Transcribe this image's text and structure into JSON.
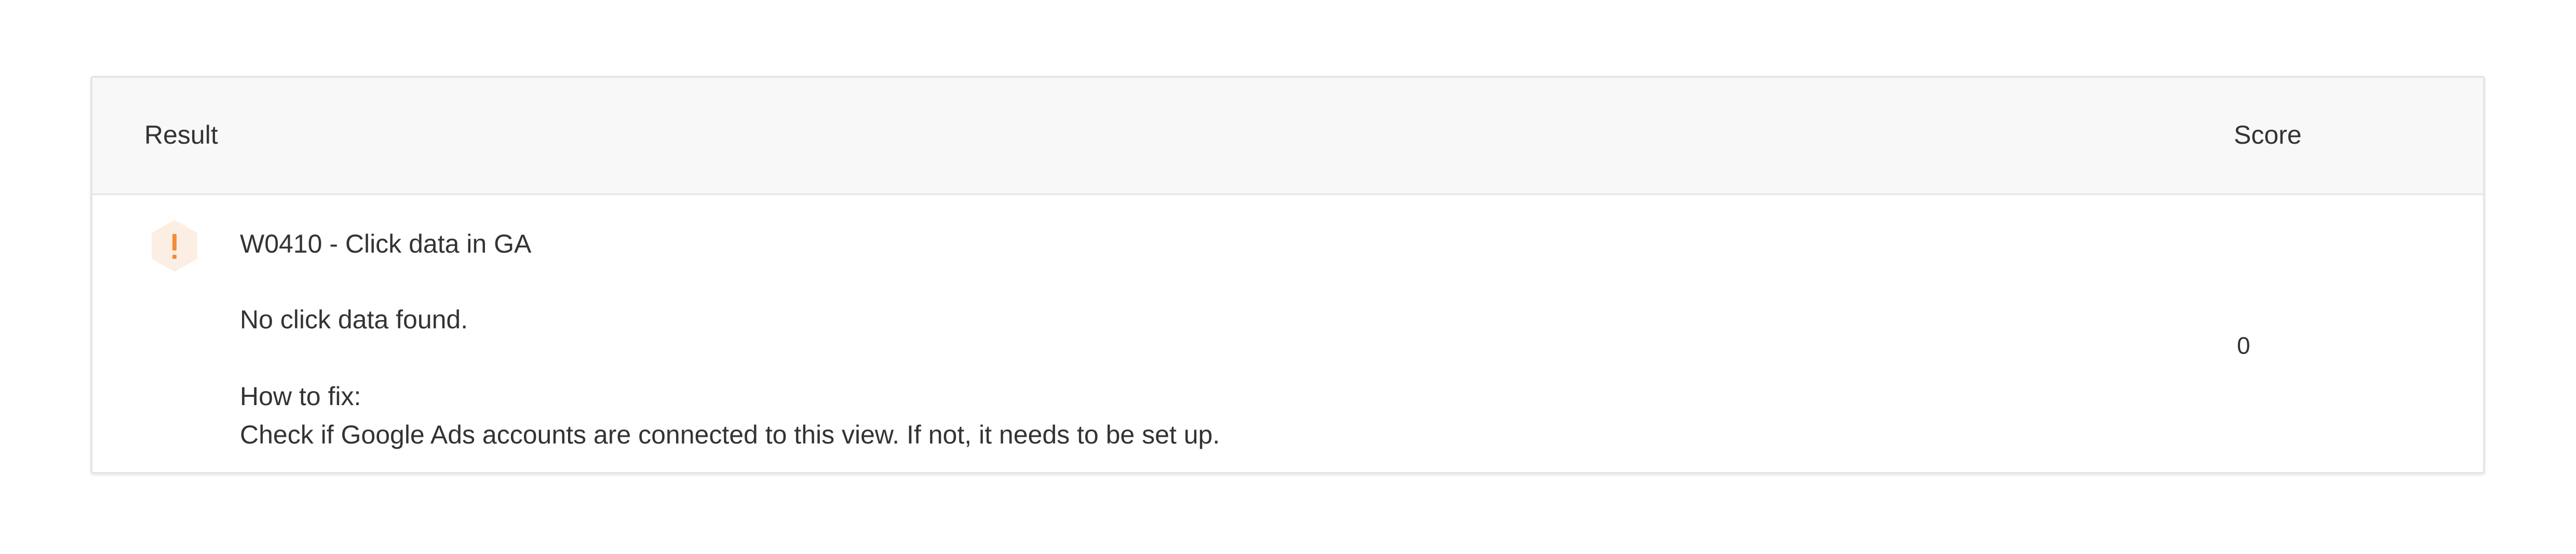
{
  "table": {
    "headers": {
      "result": "Result",
      "score": "Score"
    },
    "rows": [
      {
        "status_icon": "warning-hexagon-icon",
        "status_color": "#f28c38",
        "status_bg": "#fdeee3",
        "icon_glyph": "!",
        "title": "W0410 - Click data in GA",
        "message": "No click data found.",
        "how_to_fix_label": "How to fix:",
        "how_to_fix_text": "Check if Google Ads accounts are connected to this view. If not, it needs to be set up.",
        "score": "0"
      }
    ]
  }
}
